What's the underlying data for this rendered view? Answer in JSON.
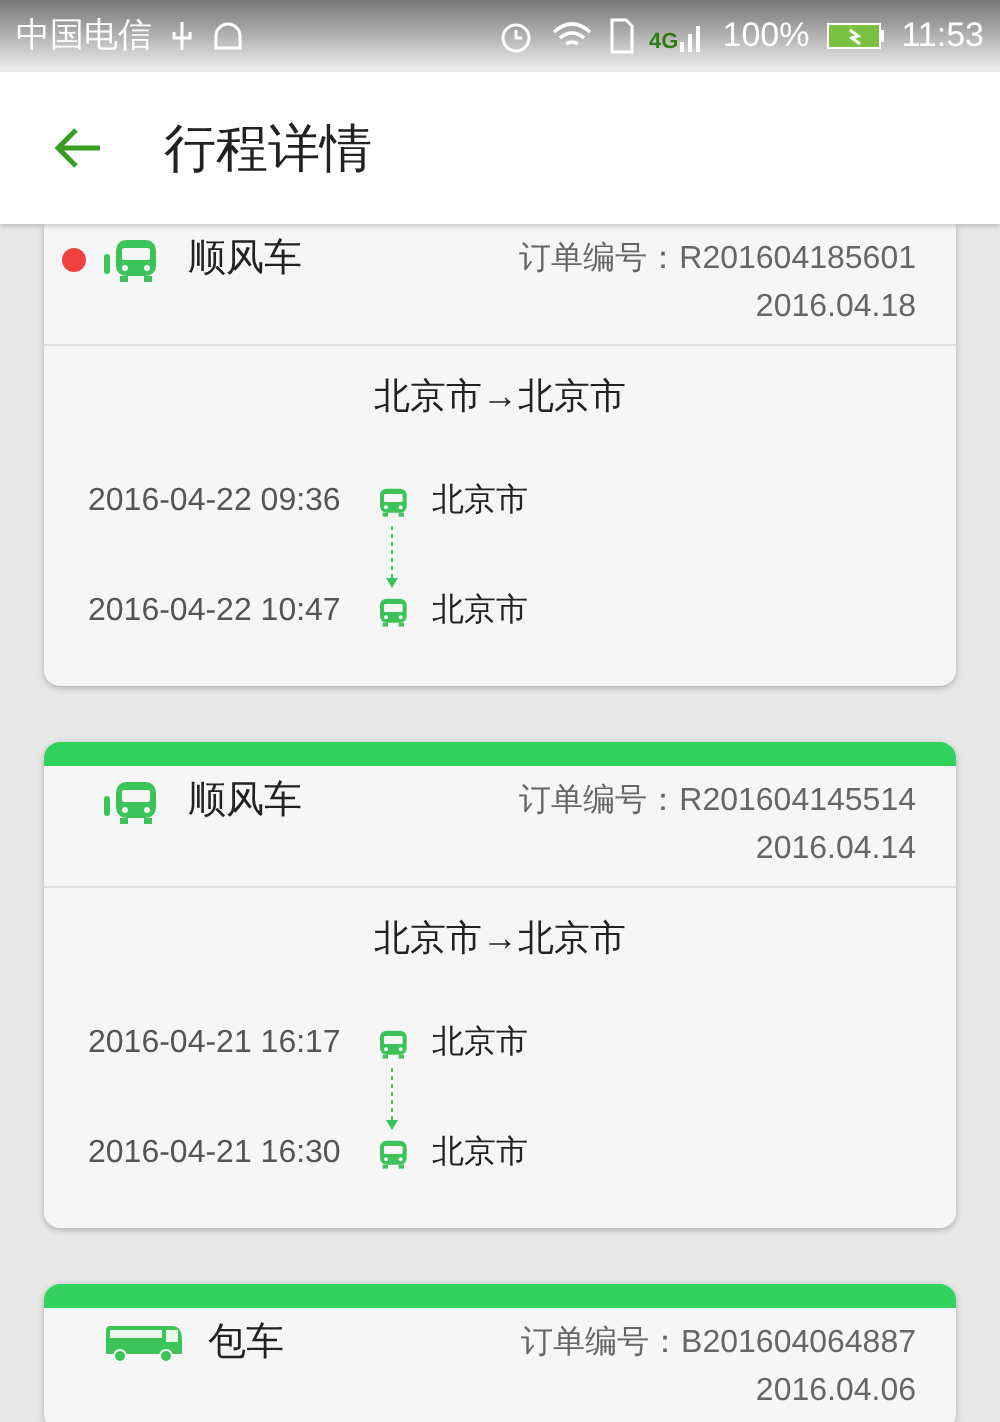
{
  "status_bar": {
    "carrier": "中国电信",
    "network": "4G",
    "battery": "100%",
    "time": "11:53"
  },
  "header": {
    "title": "行程详情"
  },
  "trips": [
    {
      "kind": "carpool",
      "unread": true,
      "top_bar": false,
      "type_label": "顺风车",
      "order_label": "订单编号：",
      "order_no": "R201604185601",
      "date": "2016.04.18",
      "route": "北京市→北京市",
      "stops": [
        {
          "time": "2016-04-22 09:36",
          "place": "北京市"
        },
        {
          "time": "2016-04-22 10:47",
          "place": "北京市"
        }
      ]
    },
    {
      "kind": "carpool",
      "unread": false,
      "top_bar": true,
      "type_label": "顺风车",
      "order_label": "订单编号：",
      "order_no": "R201604145514",
      "date": "2016.04.14",
      "route": "北京市→北京市",
      "stops": [
        {
          "time": "2016-04-21 16:17",
          "place": "北京市"
        },
        {
          "time": "2016-04-21 16:30",
          "place": "北京市"
        }
      ]
    },
    {
      "kind": "charter",
      "unread": false,
      "top_bar": true,
      "type_label": "包车",
      "order_label": "订单编号：",
      "order_no": "B201604064887",
      "date": "2016.04.06"
    }
  ]
}
